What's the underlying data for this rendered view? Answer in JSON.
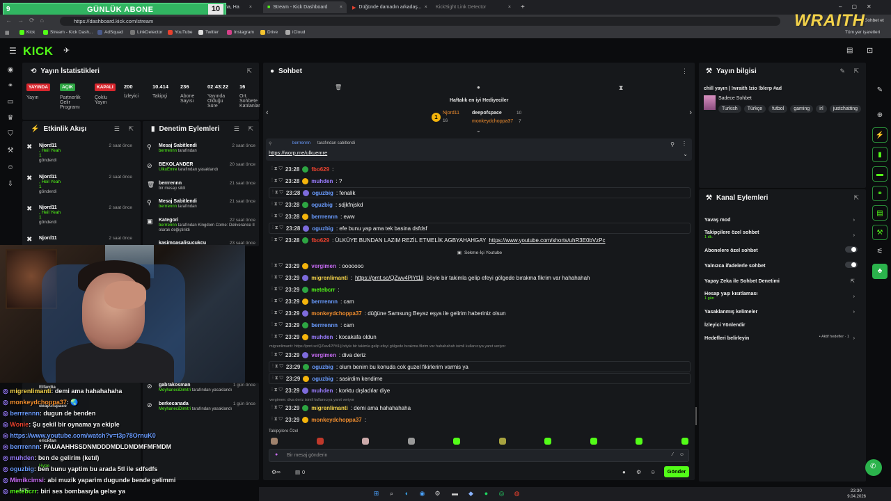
{
  "browser": {
    "tabs": [
      {
        "label": "Diyoğ Taha, Ha",
        "active": false
      },
      {
        "label": "Stream - Kick Dashboard",
        "active": true
      },
      {
        "label": "Düğünde damadın arkadaş...",
        "active": false
      },
      {
        "label": "KickSight Link Detector",
        "active": false
      }
    ],
    "url": "https://dashboard.kick.com/stream",
    "bookmarks": [
      "Kick",
      "Stream - Kick Dash...",
      "AdSquad",
      "LinkDetector",
      "YouTube",
      "Twitter",
      "Instagram",
      "Drive",
      "iCloud"
    ],
    "profile_label": "Sohbet et",
    "bookmarks_other": "Tüm yer işaretleri"
  },
  "overlay": {
    "abone_label": "GÜNLÜK ABONE",
    "abone_left": "9",
    "abone_count": "10",
    "brand": "WRAITH"
  },
  "kick": {
    "logo": "KICK"
  },
  "stats": {
    "title": "Yayın İstatistikleri",
    "items": [
      {
        "badge": "YAYINDA",
        "label": "Yayın",
        "color": "#d8262d"
      },
      {
        "badge": "AÇIK",
        "label": "Partnerlik Gelir Programı",
        "color": "#2da542"
      },
      {
        "badge": "KAPALI",
        "label": "Çoklu Yayın",
        "color": "#d8262d"
      },
      {
        "value": "200",
        "label": "İzleyici"
      },
      {
        "value": "10.414",
        "label": "Takipçi"
      },
      {
        "value": "236",
        "label": "Abone Sayısı"
      },
      {
        "value": "02:43:22",
        "label": "Yayında Olduğu Süre"
      },
      {
        "value": "16",
        "label": "Ort. Sohbete Katılanlar"
      }
    ]
  },
  "events": {
    "title": "Etkinlik Akışı",
    "items": [
      {
        "name": "Njord11",
        "time": "2 saat önce",
        "line1": ", Heil Yeah",
        "gift": "1",
        "line2": "gönderdi"
      },
      {
        "name": "Njord11",
        "time": "2 saat önce",
        "line1": ", Heil Yeah",
        "gift": "1",
        "line2": "gönderdi"
      },
      {
        "name": "Njord11",
        "time": "2 saat önce",
        "line1": ", Heil Yeah",
        "gift": "1",
        "line2": "gönderdi"
      },
      {
        "name": "Njord11",
        "time": "2 saat önce",
        "line1": ", Heil Yeah",
        "gift": "",
        "line2": ""
      }
    ]
  },
  "moderation": {
    "title": "Denetim Eylemleri",
    "items": [
      {
        "title": "Mesaj Sabitlendi",
        "time": "2 saat önce",
        "who": "berrrennn",
        "desc": " tarafından"
      },
      {
        "title": "BEKOLANDER",
        "time": "20 saat önce",
        "who": "UlkuEmre",
        "desc": " tarafından yasaklandı"
      },
      {
        "title": "berrrennn",
        "time": "21 saat önce",
        "who": "",
        "desc": "bir mesajı sildi"
      },
      {
        "title": "Mesaj Sabitlendi",
        "time": "21 saat önce",
        "who": "berrrennn",
        "desc": " tarafından"
      },
      {
        "title": "Kategori",
        "time": "22 saat önce",
        "who": "berrrennn",
        "desc": " tarafından Kingdom Come: Deliverance II olarak değiştirildi"
      },
      {
        "title": "kasimoasalisucukcu",
        "time": "23 saat önce",
        "who": "",
        "desc": ""
      },
      {
        "title": "gabrakosman",
        "time": "1 gün önce",
        "who": "MeyhaneciDimitri",
        "desc": " tarafından yasaklandı"
      },
      {
        "title": "berkecanada",
        "time": "1 gün önce",
        "who": "MeyhaneciDimitri",
        "desc": " tarafından yasaklandı"
      }
    ]
  },
  "overlay_chat": [
    {
      "user": "migrenlimanti",
      "text": ": demi ama hahahahaha",
      "ucolor": "#f4d34a"
    },
    {
      "user": "monkeydchoppa37",
      "text": ": 🌏",
      "ucolor": "#f08d2e"
    },
    {
      "user": "berrrennn",
      "text": ": dugun de benden",
      "ucolor": "#6a9cff"
    },
    {
      "user": "Wonie",
      "text": ": Şu şekil bir oynama ya ekiple",
      "ucolor": "#e8412e"
    },
    {
      "user": "",
      "text": "https://www.youtube.com/watch?v=t3p78OrnuK0",
      "ucolor": "#6a9cff"
    },
    {
      "user": "berrrennn",
      "text": ": PAUAAHHSSDNMDDDMDLDMDMFMFMDM",
      "ucolor": "#6a9cff"
    },
    {
      "user": "muhden",
      "text": ": ben de gelirim (ketıl)",
      "ucolor": "#9b7dff"
    },
    {
      "user": "oguzbig",
      "text": ": ben bunu yaptim bu arada 5tl ile sdfsdfs",
      "ucolor": "#6a9cff"
    },
    {
      "user": "Mimikcimsi",
      "text": ": abi muzik yaparim dugunde bende gelimmi",
      "ucolor": "#c86bf5"
    },
    {
      "user": "metebcrr",
      "text": ": biri ses bombasıyla gelse ya",
      "ucolor": "#53fc18"
    }
  ],
  "overlay_chat_bg": [
    {
      "text": "Elfardia"
    },
    {
      "text": "deapofspace"
    },
    {
      "text": "erickfan"
    },
    {
      "text": "Hype"
    }
  ],
  "chat": {
    "title": "Sohbet",
    "gifters_title": "Haftalık en iyi Hediyeciler",
    "gifters": [
      {
        "rank": "1",
        "name": "Njord11",
        "amount": "16"
      },
      {
        "rank": "2",
        "name": "deepofspace",
        "amount": "10"
      },
      {
        "rank": "3",
        "name": "monkeydchoppa37",
        "amount": "7"
      }
    ],
    "pinned_by": "berrrennn",
    "pinned_label": "tarafından sabitlendi",
    "pinned_link": "https://worp.me/ulkuemre",
    "divider": "Sekme-İçi Youtube",
    "followers_only": "Takipçilere Özel",
    "input_placeholder": "Bir mesaj gönderin",
    "send_label": "Gönder",
    "count": "0",
    "messages": [
      {
        "time": "23:28",
        "user": "fbo629",
        "text": ":",
        "color": "#e8412e",
        "hl": false,
        "link": ""
      },
      {
        "time": "23:28",
        "user": "muhden",
        "text": ": ?",
        "color": "#9b7dff",
        "hl": false,
        "link": ""
      },
      {
        "time": "23:28",
        "user": "oguzbig",
        "text": ": fenalik",
        "color": "#6a9cff",
        "hl": true,
        "link": ""
      },
      {
        "time": "23:28",
        "user": "oguzbig",
        "text": ": sdjkfnjskd",
        "color": "#6a9cff",
        "hl": false,
        "link": ""
      },
      {
        "time": "23:28",
        "user": "berrrennn",
        "text": ": eww",
        "color": "#6a9cff",
        "hl": false,
        "link": ""
      },
      {
        "time": "23:28",
        "user": "oguzbig",
        "text": ": efe bunu yap ama tek basina dsfdsf",
        "color": "#6a9cff",
        "hl": true,
        "link": ""
      },
      {
        "time": "23:28",
        "user": "fbo629",
        "text": ": ÜLKÜYE BUNDAN LAZIM REZİL ETMELİK AGBYAHAHGAY ",
        "color": "#e8412e",
        "hl": false,
        "link": "https://www.youtube.com/shorts/uhR3E0bVzPc"
      },
      {
        "time": "23:29",
        "user": "vergimen",
        "text": ": ooooooo",
        "color": "#c86bf5",
        "hl": false,
        "link": ""
      },
      {
        "time": "23:29",
        "user": "migrenlimanti",
        "text": " böyle bir takimla gelip efeyi gölgede bırakma fikrim var hahahahah",
        "color": "#f4d34a",
        "hl": false,
        "link": "https://prnt.sc/QZwv4PlYt1Ij",
        "pre": ": "
      },
      {
        "time": "23:29",
        "user": "metebcrr",
        "text": ":",
        "color": "#53fc18",
        "hl": false,
        "link": ""
      },
      {
        "time": "23:29",
        "user": "berrrennn",
        "text": ": cam",
        "color": "#6a9cff",
        "hl": false,
        "link": ""
      },
      {
        "time": "23:29",
        "user": "monkeydchoppa37",
        "text": ": düğüne Samsung Beyaz eşya ile gelirim haberiniz olsun",
        "color": "#f08d2e",
        "hl": false,
        "link": ""
      },
      {
        "time": "23:29",
        "user": "berrrennn",
        "text": ": cam",
        "color": "#6a9cff",
        "hl": false,
        "link": ""
      },
      {
        "time": "23:29",
        "user": "muhden",
        "text": ": kocakafa oldun",
        "color": "#9b7dff",
        "hl": false,
        "link": ""
      },
      {
        "time": "23:29",
        "user": "vergimen",
        "text": ": diva deriz",
        "color": "#c86bf5",
        "hl": false,
        "link": ""
      },
      {
        "time": "23:29",
        "user": "oguzbig",
        "text": ": olum benim bu konuda cok guzel fikirlerim varmis ya",
        "color": "#6a9cff",
        "hl": true,
        "link": ""
      },
      {
        "time": "23:29",
        "user": "oguzbig",
        "text": ": sasirdim kendime",
        "color": "#6a9cff",
        "hl": true,
        "link": ""
      },
      {
        "time": "23:29",
        "user": "muhden",
        "text": ": korktu dışladılar diye",
        "color": "#9b7dff",
        "hl": false,
        "link": ""
      },
      {
        "time": "23:29",
        "user": "migrenlimanti",
        "text": ": demi ama hahahahaha",
        "color": "#f4d34a",
        "hl": false,
        "link": ""
      },
      {
        "time": "23:29",
        "user": "monkeydchoppa37",
        "text": ":",
        "color": "#f08d2e",
        "hl": false,
        "link": ""
      }
    ],
    "replies": [
      "migrenlimanti: https://prnt.sc/QZwv4PlYt1Ij böyle bir takimla gelip efeyi gölgede bırakma fikrim var hahahahah isimli kullanıcıya yanıt veriyor",
      "vergimen: diva deriz isimli kullanıcıya yanıt veriyor"
    ]
  },
  "info": {
    "title": "Yayın bilgisi",
    "stream_title": "chill yayın | !wraith !zio !blerp #ad",
    "category": "Sadece Sohbet",
    "tags": [
      "Turkish",
      "Türkçe",
      "futbol",
      "gaming",
      "irl",
      "justchatting"
    ]
  },
  "actions": {
    "title": "Kanal Eylemleri",
    "items": [
      {
        "label": "Yavaş mod",
        "sub": "",
        "ctrl": "chevron"
      },
      {
        "label": "Takipçilere özel sohbet",
        "sub": "1 dk.",
        "ctrl": "chevron"
      },
      {
        "label": "Abonelere özel sohbet",
        "sub": "",
        "ctrl": "toggle"
      },
      {
        "label": "Yalnızca ifadelerle sohbet",
        "sub": "",
        "ctrl": "toggle"
      },
      {
        "label": "Yapay Zeka ile Sohbet Denetimi",
        "sub": "",
        "ctrl": "external"
      },
      {
        "label": "Hesap yaşı kısıtlaması",
        "sub": "1 gün",
        "ctrl": "chevron"
      },
      {
        "label": "Yasaklanmış kelimeler",
        "sub": "",
        "ctrl": "chevron"
      },
      {
        "label": "İzleyici Yönlendir",
        "sub": "",
        "ctrl": ""
      },
      {
        "label": "Hedefleri belirleyin",
        "sub": "",
        "ctrl": "chevron",
        "right": "• Aktif hedefler · 1"
      }
    ]
  },
  "taskbar": {
    "time": "23:30",
    "date": "9.04.2026",
    "weather": "10°C"
  }
}
